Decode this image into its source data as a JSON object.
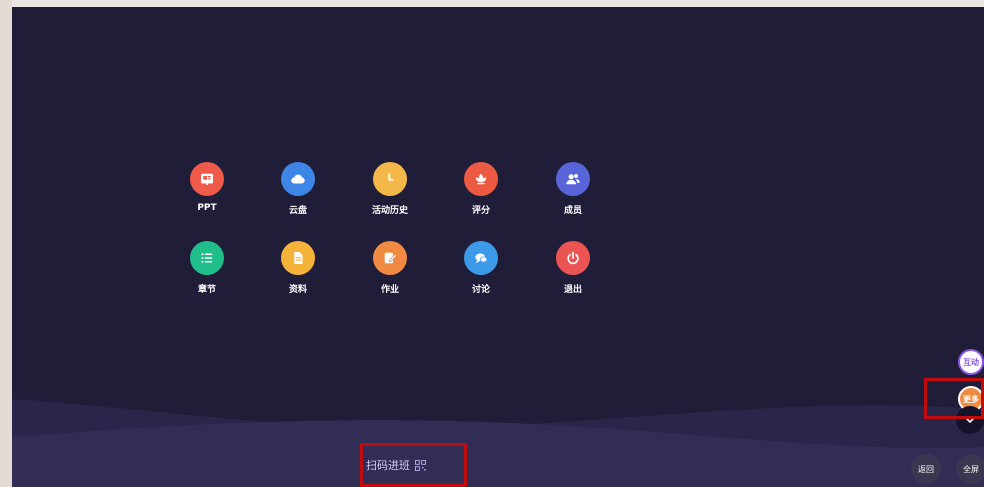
{
  "menu": {
    "items": [
      {
        "label": "PPT",
        "icon": "ppt-icon",
        "color": "#ef5a4a"
      },
      {
        "label": "云盘",
        "icon": "cloud-icon",
        "color": "#3d86e6"
      },
      {
        "label": "活动历史",
        "icon": "clock-icon",
        "color": "#f4b84a"
      },
      {
        "label": "评分",
        "icon": "lotus-icon",
        "color": "#ec5a44"
      },
      {
        "label": "成员",
        "icon": "members-icon",
        "color": "#5865d9"
      },
      {
        "label": "章节",
        "icon": "list-icon",
        "color": "#20be8b"
      },
      {
        "label": "资料",
        "icon": "document-icon",
        "color": "#f6b33a"
      },
      {
        "label": "作业",
        "icon": "edit-icon",
        "color": "#f08a42"
      },
      {
        "label": "讨论",
        "icon": "chat-icon",
        "color": "#3c9ae9"
      },
      {
        "label": "退出",
        "icon": "power-icon",
        "color": "#ea5453"
      }
    ]
  },
  "footer": {
    "scan_join_label": "扫码进班"
  },
  "side": {
    "interact_label": "互动",
    "more_label": "更多",
    "back_label": "返回",
    "fullscreen_label": "全屏"
  },
  "colors": {
    "stage_background": "#201d38",
    "highlight_border": "#c00c0c",
    "interact_accent": "#8a56e8",
    "more_accent": "#f08a42"
  }
}
